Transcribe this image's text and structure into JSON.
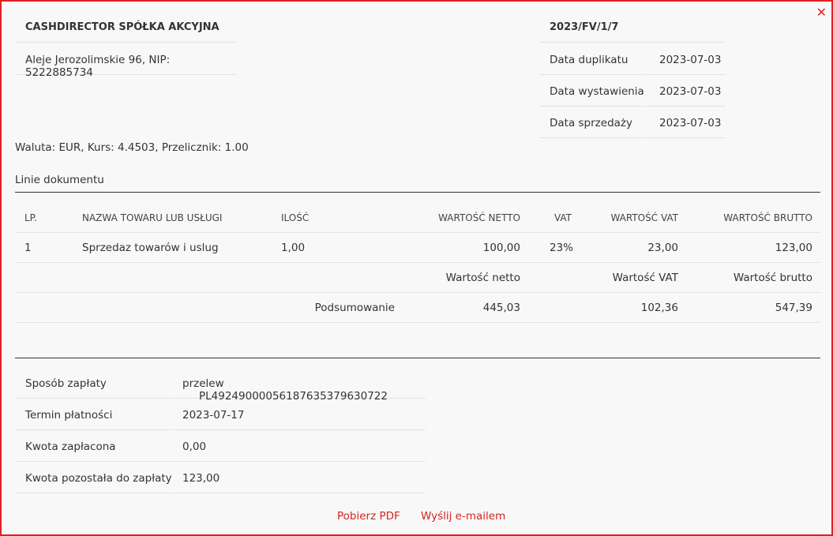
{
  "seller": {
    "name": "CASHDIRECTOR SPÓŁKA AKCYJNA",
    "address": "Aleje Jerozolimskie 96, NIP: 5222885734"
  },
  "document": {
    "number": "2023/FV/1/7",
    "rows": [
      {
        "label": "Data duplikatu",
        "value": "2023-07-03"
      },
      {
        "label": "Data wystawienia",
        "value": "2023-07-03"
      },
      {
        "label": "Data sprzedaży",
        "value": "2023-07-03"
      }
    ]
  },
  "currency_line": "Waluta: EUR, Kurs: 4.4503, Przelicznik: 1.00",
  "lines_title": "Linie dokumentu",
  "table": {
    "headers": {
      "lp": "LP.",
      "name": "NAZWA TOWARU LUB USŁUGI",
      "qty": "ILOŚĆ",
      "net": "WARTOŚĆ NETTO",
      "vat": "VAT",
      "vat_value": "WARTOŚĆ VAT",
      "gross": "WARTOŚĆ BRUTTO"
    },
    "rows": [
      {
        "lp": "1",
        "name": "Sprzedaz towarów i uslug",
        "qty": "1,00",
        "net": "100,00",
        "vat": "23%",
        "vat_value": "23,00",
        "gross": "123,00"
      }
    ],
    "summary_headers": {
      "net": "Wartość netto",
      "vat_value": "Wartość VAT",
      "gross": "Wartość brutto"
    },
    "summary": {
      "label": "Podsumowanie",
      "net": "445,03",
      "vat_value": "102,36",
      "gross": "547,39"
    }
  },
  "payment": [
    {
      "label": "Sposób zapłaty",
      "value": "przelew",
      "extra": "PL49249000056187635379630722"
    },
    {
      "label": "Termin płatności",
      "value": "2023-07-17"
    },
    {
      "label": "Kwota zapłacona",
      "value": "0,00"
    },
    {
      "label": "Kwota pozostała do zapłaty",
      "value": "123,00"
    }
  ],
  "actions": {
    "pdf": "Pobierz PDF",
    "email": "Wyślij e-mailem"
  },
  "colors": {
    "accent": "#e02020",
    "link": "#d42424"
  },
  "icons": {
    "close": "close-icon"
  }
}
